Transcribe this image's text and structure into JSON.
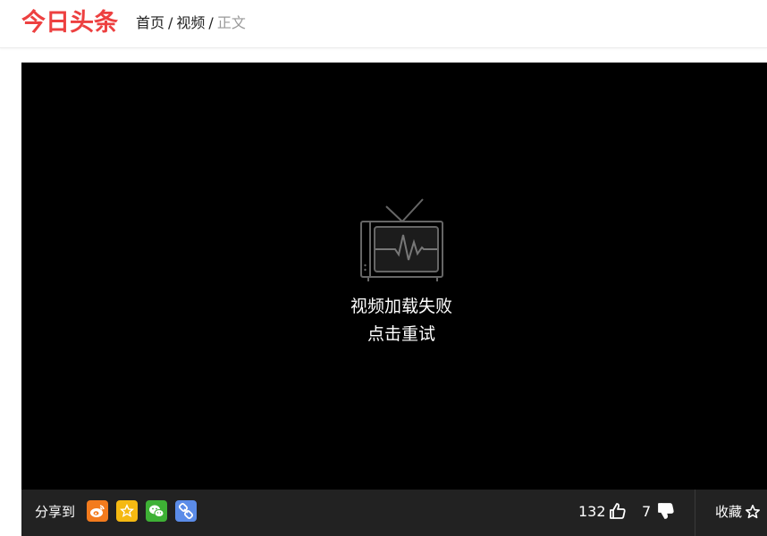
{
  "header": {
    "logo": "今日头条",
    "breadcrumb": {
      "home": "首页",
      "video": "视频",
      "current": "正文",
      "separator": "/"
    }
  },
  "player": {
    "error_title": "视频加载失败",
    "retry_label": "点击重试",
    "icon": "broken-tv-icon"
  },
  "toolbar": {
    "share_label": "分享到",
    "share_targets": [
      {
        "name": "weibo",
        "icon": "weibo-icon",
        "color": "#f37b1d"
      },
      {
        "name": "qzone",
        "icon": "qzone-star-icon",
        "color": "#f5b912"
      },
      {
        "name": "wechat",
        "icon": "wechat-icon",
        "color": "#3eb135"
      },
      {
        "name": "copy-link",
        "icon": "link-icon",
        "color": "#5b8ce8"
      }
    ],
    "like_count": "132",
    "dislike_count": "7",
    "favorite_label": "收藏"
  },
  "colors": {
    "brand": "#ed4040",
    "player_bg": "#000000",
    "toolbar_bg": "#222222"
  }
}
